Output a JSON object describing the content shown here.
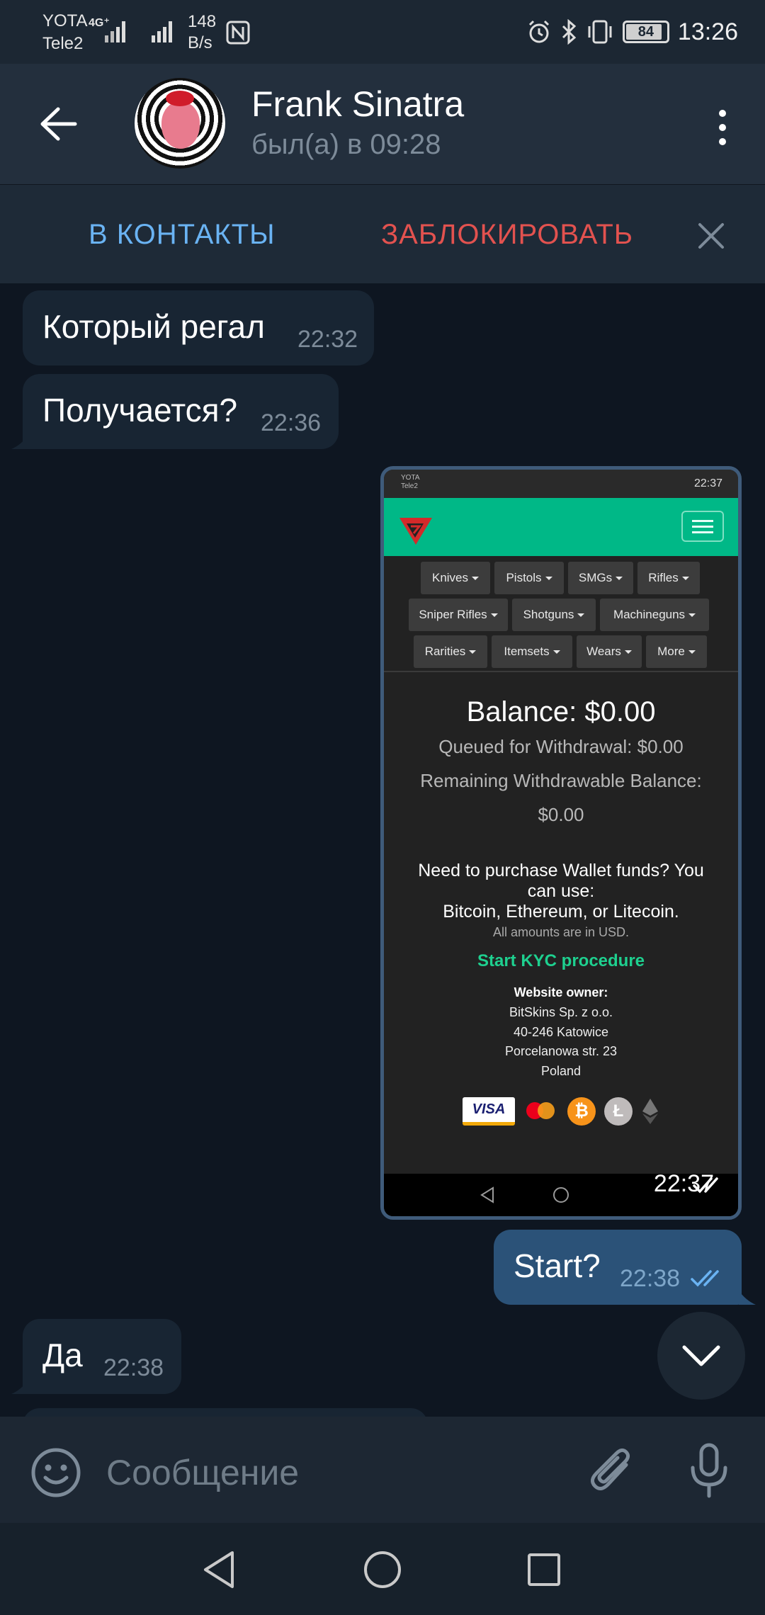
{
  "status_bar": {
    "carrier1": "YOTA",
    "carrier2": "Tele2",
    "network": "4G⁺",
    "speed_value": "148",
    "speed_unit": "B/s",
    "battery": "84",
    "time": "13:26"
  },
  "header": {
    "name": "Frank Sinatra",
    "status": "был(а) в 09:28"
  },
  "actions": {
    "add_contact": "В КОНТАКТЫ",
    "block": "ЗАБЛОКИРОВАТЬ"
  },
  "messages": [
    {
      "direction": "in",
      "text": "Который регал",
      "time": "22:32"
    },
    {
      "direction": "in",
      "text": "Получается?",
      "time": "22:36"
    },
    {
      "direction": "out",
      "type": "photo",
      "time": "22:37"
    },
    {
      "direction": "out",
      "text": "Start?",
      "time": "22:38"
    },
    {
      "direction": "in",
      "text": "Да",
      "time": "22:38"
    }
  ],
  "photo": {
    "status_carrier1": "YOTA",
    "status_carrier2": "Tele2",
    "status_time": "22:37",
    "menu": [
      "Knives",
      "Pistols",
      "SMGs",
      "Rifles",
      "Sniper Rifles",
      "Shotguns",
      "Machineguns",
      "Rarities",
      "Itemsets",
      "Wears",
      "More"
    ],
    "balance": "Balance: $0.00",
    "queued": "Queued for Withdrawal: $0.00",
    "remaining1": "Remaining Withdrawable Balance:",
    "remaining2": "$0.00",
    "purchase1": "Need to purchase Wallet funds? You",
    "purchase2": "can use:",
    "purchase3": "Bitcoin, Ethereum, or Litecoin.",
    "amounts": "All amounts are in USD.",
    "kyc": "Start KYC procedure",
    "owner_label": "Website owner:",
    "owner_lines": [
      "BitSkins Sp. z o.o.",
      "40-246 Katowice",
      "Porcelanowa str. 23",
      "Poland"
    ],
    "visa": "VISA"
  },
  "input": {
    "placeholder": "Сообщение"
  },
  "colors": {
    "accent_blue": "#6ab3f3",
    "danger_red": "#e2524f",
    "kyc_green": "#1ed08f",
    "site_nav_green": "#00b887"
  }
}
